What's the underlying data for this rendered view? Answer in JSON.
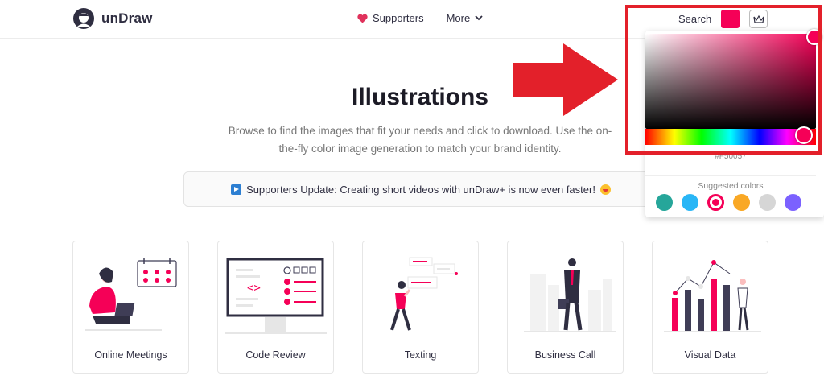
{
  "header": {
    "logo_text": "unDraw",
    "nav": {
      "supporters": "Supporters",
      "more": "More"
    },
    "search": "Search",
    "accent_color": "#f50057"
  },
  "hero": {
    "title": "Illustrations",
    "subtitle": "Browse to find the images that fit your needs and click to download. Use the on-the-fly color image generation to match your brand identity.",
    "banner": "Supporters Update: Creating short videos with unDraw+ is now even faster!"
  },
  "cards": [
    {
      "label": "Online Meetings"
    },
    {
      "label": "Code Review"
    },
    {
      "label": "Texting"
    },
    {
      "label": "Business Call"
    },
    {
      "label": "Visual Data"
    }
  ],
  "picker": {
    "hex": "#F50057",
    "suggested_label": "Suggested colors",
    "suggested": [
      "#26a69a",
      "#29b6f6",
      "#f50057",
      "#f9a825",
      "#d6d6d6",
      "#7b61ff"
    ],
    "selected_index": 2
  },
  "annotation": {
    "color": "#e3202a"
  }
}
